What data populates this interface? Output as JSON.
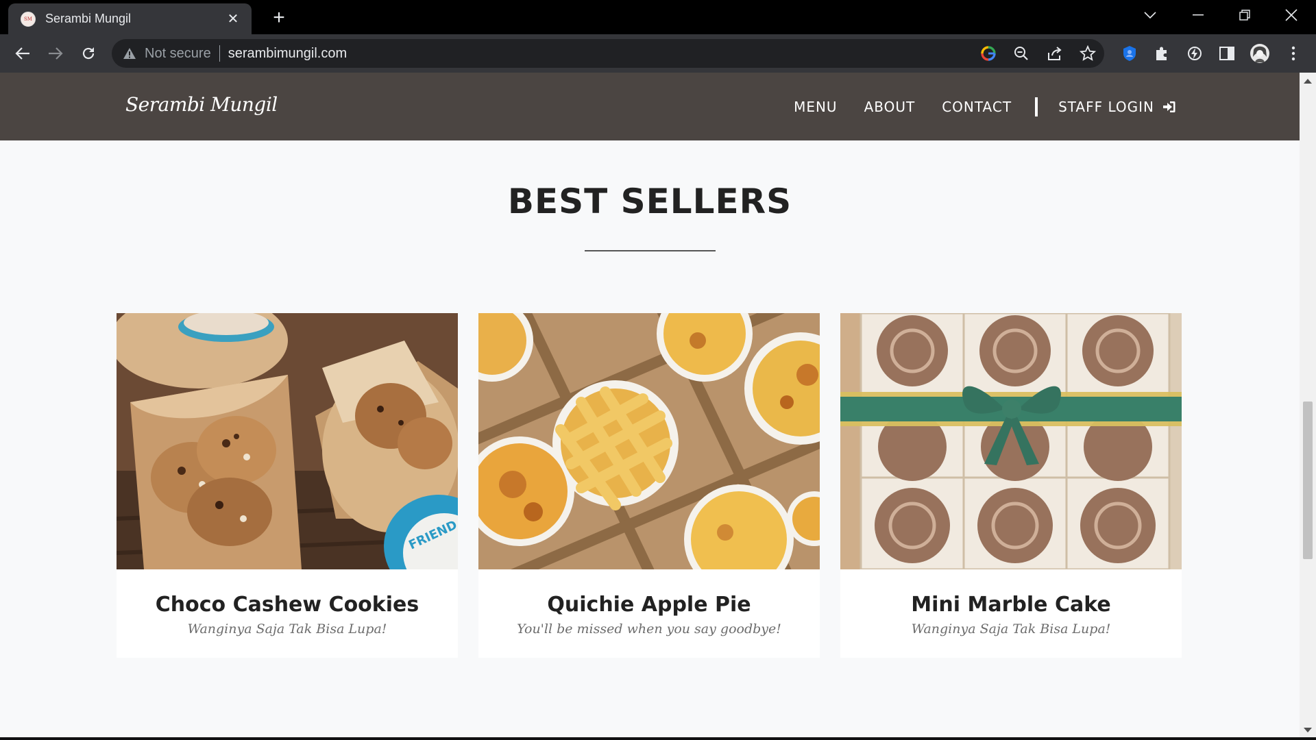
{
  "browser": {
    "tab_title": "Serambi Mungil",
    "favicon_text": "SM",
    "not_secure_label": "Not secure",
    "url": "serambimungil.com"
  },
  "site": {
    "brand": "Serambi Mungil",
    "nav": {
      "menu": "MENU",
      "about": "ABOUT",
      "contact": "CONTACT",
      "staff_login": "STAFF LOGIN"
    },
    "section_title": "BEST SELLERS",
    "products": [
      {
        "name": "Choco Cashew Cookies",
        "tagline": "Wanginya Saja Tak Bisa Lupa!"
      },
      {
        "name": "Quichie Apple Pie",
        "tagline": "You'll be missed when you say goodbye!"
      },
      {
        "name": "Mini Marble Cake",
        "tagline": "Wanginya Saja Tak Bisa Lupa!"
      }
    ],
    "cookie_cup_text": "FRIEND"
  },
  "colors": {
    "nav_bg": "#4b4542",
    "page_bg": "#f8f9fa",
    "ribbon": "#1e6f55"
  }
}
